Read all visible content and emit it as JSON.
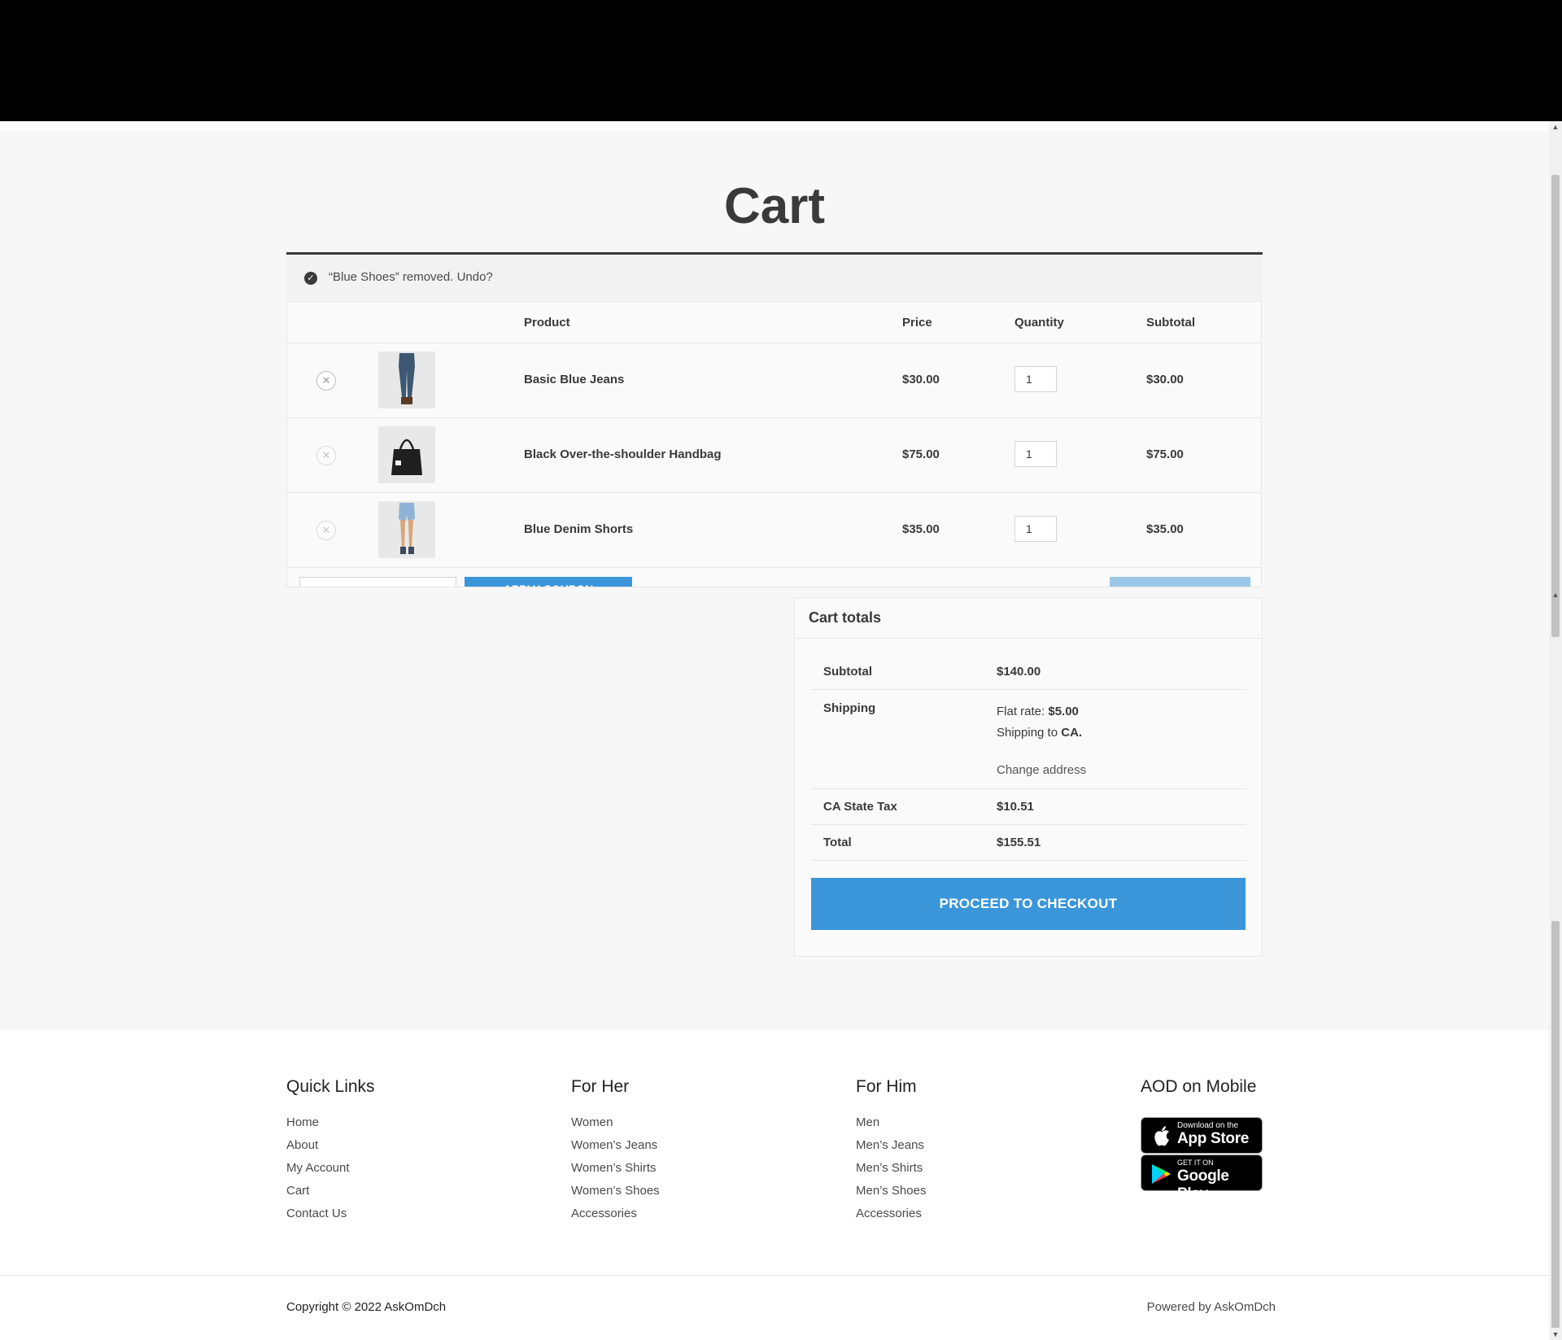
{
  "page": {
    "title": "Cart"
  },
  "notice": {
    "message": "“Blue Shoes” removed. Undo?"
  },
  "table": {
    "headers": {
      "product": "Product",
      "price": "Price",
      "quantity": "Quantity",
      "subtotal": "Subtotal"
    },
    "rows": [
      {
        "name": "Basic Blue Jeans",
        "price": "$30.00",
        "qty": "1",
        "subtotal": "$30.00",
        "remove_icon": "close-circle-icon"
      },
      {
        "name": "Black Over-the-shoulder Handbag",
        "price": "$75.00",
        "qty": "1",
        "subtotal": "$75.00",
        "remove_icon": "close-circle-icon"
      },
      {
        "name": "Blue Denim Shorts",
        "price": "$35.00",
        "qty": "1",
        "subtotal": "$35.00",
        "remove_icon": "close-circle-icon"
      }
    ],
    "apply_coupon_label": "APPLY COUPON"
  },
  "totals": {
    "heading": "Cart totals",
    "subtotal_label": "Subtotal",
    "subtotal_value": "$140.00",
    "shipping_label": "Shipping",
    "flat_rate_label": "Flat rate:",
    "flat_rate_value": "$5.00",
    "shipping_to_label": "Shipping to",
    "shipping_to_value": "CA.",
    "change_address": "Change address",
    "tax_label": "CA State Tax",
    "tax_value": "$10.51",
    "total_label": "Total",
    "total_value": "$155.51",
    "checkout_label": "PROCEED TO CHECKOUT"
  },
  "footer": {
    "columns": [
      {
        "heading": "Quick Links",
        "links": [
          "Home",
          "About",
          "My Account",
          "Cart",
          "Contact Us"
        ]
      },
      {
        "heading": "For Her",
        "links": [
          "Women",
          "Women’s Jeans",
          "Women’s Shirts",
          "Women’s Shoes",
          "Accessories"
        ]
      },
      {
        "heading": "For Him",
        "links": [
          "Men",
          "Men’s Jeans",
          "Men’s Shirts",
          "Men’s Shoes",
          "Accessories"
        ]
      }
    ],
    "mobile": {
      "heading": "AOD on Mobile",
      "app_store_small": "Download on the",
      "app_store_big": "App Store",
      "google_small": "GET IT ON",
      "google_big": "Google Play"
    },
    "copyright": "Copyright © 2022 AskOmDch",
    "powered_by": "Powered by AskOmDch"
  },
  "colors": {
    "accent": "#3a96d9",
    "text": "#3a3a3a",
    "background": "#f7f7f7",
    "header": "#000000"
  }
}
